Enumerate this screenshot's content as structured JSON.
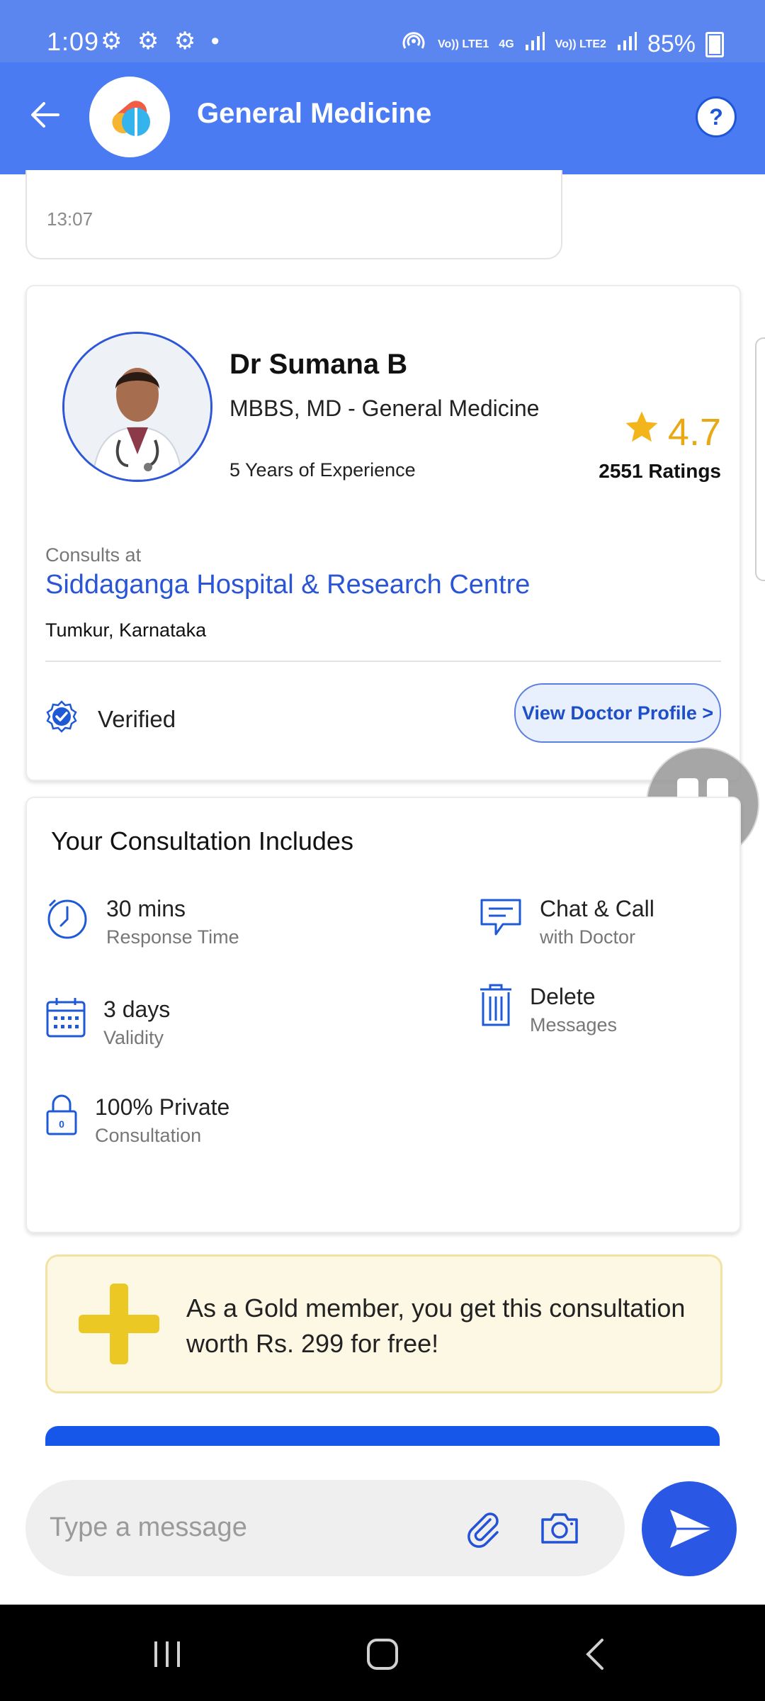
{
  "status_bar": {
    "time": "1:09",
    "indicators": "⚙ ⚙ ⚙ •",
    "lte1": "Vo)) LTE1",
    "net": "4G",
    "lte2": "Vo)) LTE2",
    "battery": "85%"
  },
  "header": {
    "title": "General Medicine"
  },
  "previous_message": {
    "time": "13:07"
  },
  "doctor": {
    "name": "Dr Sumana B",
    "qualification": "MBBS, MD - General Medicine",
    "experience": "5 Years of Experience",
    "rating": "4.7",
    "ratings_count": "2551 Ratings",
    "consults_at_label": "Consults at",
    "hospital": "Siddaganga Hospital & Research Centre",
    "location": "Tumkur, Karnataka",
    "verified_label": "Verified",
    "view_profile_label": "View Doctor Profile >"
  },
  "consultation": {
    "title": "Your Consultation Includes",
    "features": [
      {
        "main": "30 mins",
        "sub": "Response Time",
        "icon": "clock-icon"
      },
      {
        "main": "Chat & Call",
        "sub": "with Doctor",
        "icon": "chat-icon"
      },
      {
        "main": "3 days",
        "sub": "Validity",
        "icon": "calendar-icon"
      },
      {
        "main": "Delete",
        "sub": "Messages",
        "icon": "trash-icon"
      },
      {
        "main": "100% Private",
        "sub": "Consultation",
        "icon": "lock-icon"
      }
    ]
  },
  "gold_banner": {
    "text": "As a Gold member, you get this consultation worth Rs. 299 for free!"
  },
  "composer": {
    "placeholder": "Type a message"
  },
  "colors": {
    "primary": "#4a7bf3",
    "accent_blue": "#2a55d6",
    "gold": "#ecc824",
    "rating": "#e8a915"
  }
}
